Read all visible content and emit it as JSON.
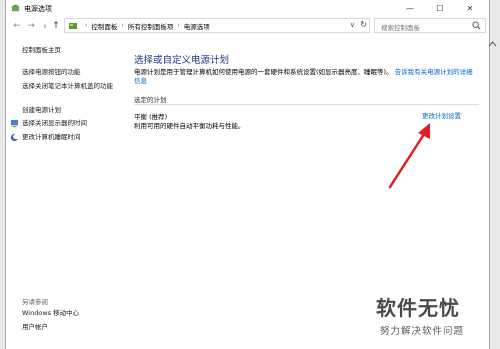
{
  "window": {
    "title": "电源选项"
  },
  "nav": {
    "back_icon": "back-arrow-icon",
    "forward_icon": "forward-arrow-icon",
    "up_icon": "up-arrow-icon",
    "breadcrumb": [
      "控制面板",
      "所有控制面板项",
      "电源选项"
    ],
    "search_placeholder": "搜索控制面板"
  },
  "sidebar": {
    "home": "控制面板主页",
    "items": [
      "选择电源按钮的功能",
      "选择关闭笔记本计算机盖的功能",
      "创建电源计划",
      "选择关闭显示器的时间",
      "更改计算机睡眠时间"
    ],
    "see_also": "另请参阅",
    "see_also_items": [
      "Windows 移动中心",
      "用户帐户"
    ]
  },
  "main": {
    "heading": "选择或自定义电源计划",
    "description": "电源计划是用于管理计算机如何使用电源的一套硬件和系统设置(如显示器亮度、睡眠等)。",
    "description_link": "告诉我有关电源计划的详细信息",
    "selected_label": "选定的计划",
    "plan_name": "平衡 (推荐)",
    "plan_desc": "利用可用的硬件自动平衡功耗与性能。",
    "change_link": "更改计划设置"
  },
  "watermark": {
    "title": "软件无忧",
    "subtitle": "努力解决软件问题"
  },
  "colors": {
    "heading": "#1e3287",
    "link": "#0066cc",
    "arrow": "#e02020"
  }
}
